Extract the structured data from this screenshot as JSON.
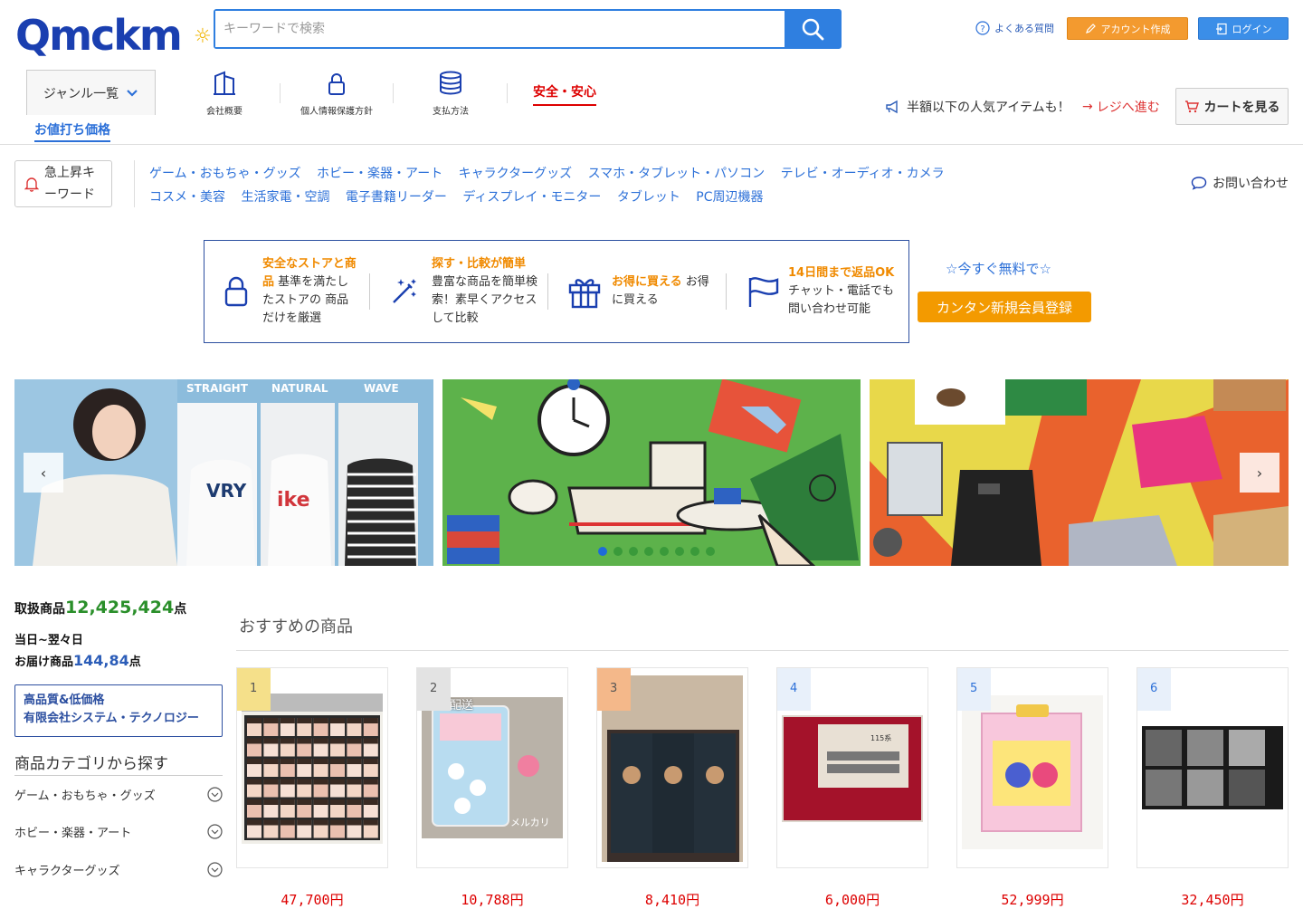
{
  "header": {
    "logo": "Qmckm",
    "search_placeholder": "キーワードで検索",
    "faq": "よくある質問",
    "create_account": "アカウント作成",
    "login": "ログイン"
  },
  "nav": {
    "genre": "ジャンル一覧",
    "items": [
      "会社概要",
      "個人情報保護方針",
      "支払方法"
    ],
    "safety": "安全・安心",
    "promo": "半額以下の人気アイテムも！",
    "checkout": "レジへ進む",
    "cart": "カートを見る",
    "discount_tab": "お値打ち価格"
  },
  "trending": {
    "label": "急上昇キーワード",
    "categories": [
      "ゲーム・おもちゃ・グッズ",
      "ホビー・楽器・アート",
      "キャラクターグッズ",
      "スマホ・タブレット・パソコン",
      "テレビ・オーディオ・カメラ",
      "コスメ・美容",
      "生活家電・空調",
      "電子書籍リーダー",
      "ディスプレイ・モニター",
      "タブレット",
      "PC周辺機器"
    ],
    "contact": "お問い合わせ"
  },
  "features": [
    {
      "highlight": "安全なストアと商品",
      "text": "基準を満たしたストアの 商品だけを厳選"
    },
    {
      "highlight": "探す・比較が簡単",
      "text": "豊富な商品を簡単検索！素早くアクセスして比較"
    },
    {
      "highlight": "お得に買える",
      "text": "お得に買える"
    },
    {
      "highlight": "14日間まで返品OK",
      "text": "チャット・電話でも 問い合わせ可能"
    }
  ],
  "signup": {
    "tagline": "☆今すぐ無料で☆",
    "button": "カンタン新規会員登録"
  },
  "banners": {
    "labels": [
      "STRAIGHT",
      "NATURAL",
      "WAVE"
    ],
    "prev": "‹",
    "next": "›",
    "dot_count": 8,
    "active_dot": 0
  },
  "stats": {
    "total_label": "取扱商品",
    "total_value": "12,425,424",
    "total_unit": "点",
    "delivery_line1": "当日~翌々日",
    "delivery_label": "お届け商品",
    "delivery_value": "144,84",
    "delivery_unit": "点"
  },
  "quality_box": {
    "line1": "高品質&低価格",
    "line2": "有限会社システム・テクノロジー"
  },
  "sidebar": {
    "title": "商品カテゴリから探す",
    "items": [
      "ゲーム・おもちゃ・グッズ",
      "ホビー・楽器・アート",
      "キャラクターグッズ"
    ]
  },
  "recommended": {
    "title": "おすすめの商品",
    "products": [
      {
        "rank": "1",
        "price": "47,700円",
        "rank_color": "#f5e08a"
      },
      {
        "rank": "2",
        "price": "10,788円",
        "rank_color": "#e3e3e3",
        "overlay": "配送",
        "watermark": "メルカリ"
      },
      {
        "rank": "3",
        "price": "8,410円",
        "rank_color": "#f4b88a"
      },
      {
        "rank": "4",
        "price": "6,000円",
        "rank_color": "#e8f0fa"
      },
      {
        "rank": "5",
        "price": "52,999円",
        "rank_color": "#e8f0fa"
      },
      {
        "rank": "6",
        "price": "32,450円",
        "rank_color": "#e8f0fa"
      }
    ]
  },
  "colors": {
    "brand": "#1a3fb0",
    "accent": "#2f7fe0",
    "orange": "#f39a00",
    "price": "#d00"
  }
}
